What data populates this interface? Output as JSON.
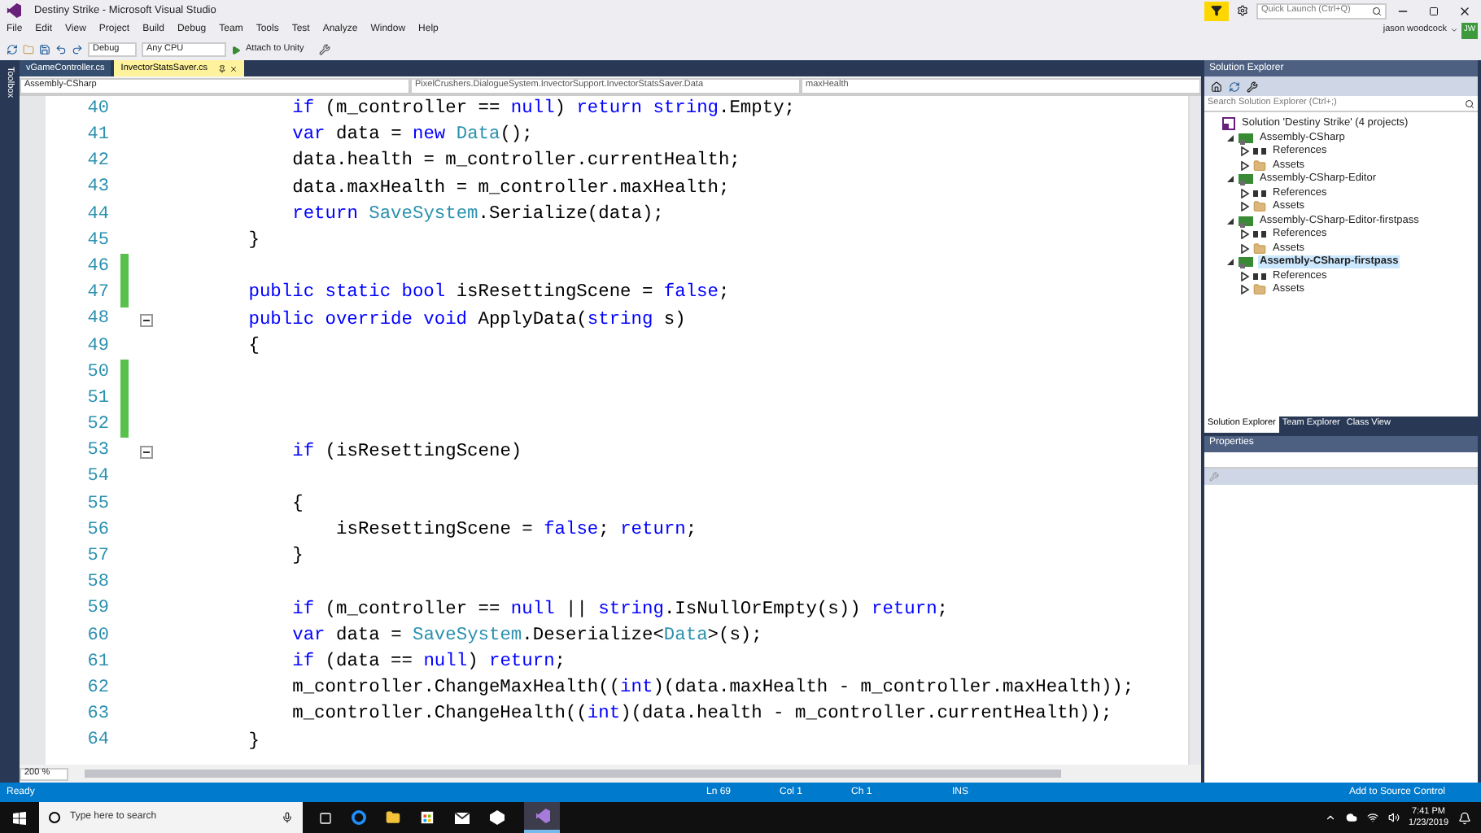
{
  "window": {
    "title": "Destiny Strike - Microsoft Visual Studio"
  },
  "quick_launch": {
    "placeholder": "Quick Launch (Ctrl+Q)"
  },
  "menu": [
    "File",
    "Edit",
    "View",
    "Project",
    "Build",
    "Debug",
    "Team",
    "Tools",
    "Test",
    "Analyze",
    "Window",
    "Help"
  ],
  "user": {
    "name": "jason woodcock",
    "initials": "JW"
  },
  "toolbar": {
    "configuration": "Debug",
    "platform": "Any CPU",
    "run_button": "Attach to Unity"
  },
  "toolbox_label": "Toolbox",
  "editor_tabs": [
    {
      "label": "vGameController.cs",
      "selected": false
    },
    {
      "label": "InvectorStatsSaver.cs",
      "selected": true
    }
  ],
  "nav_bar": {
    "project": "Assembly-CSharp",
    "type": "PixelCrushers.DialogueSystem.InvectorSupport.InvectorStatsSaver.Data",
    "member": "maxHealth"
  },
  "code_lines": [
    {
      "number": "40",
      "changed": false,
      "collapsible": false,
      "tokens": [
        {
          "text": "            if",
          "kind": "keyword"
        },
        {
          "text": " (m_controller == ",
          "kind": "plain"
        },
        {
          "text": "null",
          "kind": "keyword"
        },
        {
          "text": ") ",
          "kind": "plain"
        },
        {
          "text": "return string",
          "kind": "keyword"
        },
        {
          "text": ".Empty;",
          "kind": "plain"
        }
      ]
    },
    {
      "number": "41",
      "changed": false,
      "collapsible": false,
      "tokens": [
        {
          "text": "            var",
          "kind": "keyword"
        },
        {
          "text": " data = ",
          "kind": "plain"
        },
        {
          "text": "new ",
          "kind": "keyword"
        },
        {
          "text": "Data",
          "kind": "type"
        },
        {
          "text": "();",
          "kind": "plain"
        }
      ]
    },
    {
      "number": "42",
      "changed": false,
      "collapsible": false,
      "tokens": [
        {
          "text": "            data.health = m_controller.currentHealth;",
          "kind": "plain"
        }
      ]
    },
    {
      "number": "43",
      "changed": false,
      "collapsible": false,
      "tokens": [
        {
          "text": "            data.maxHealth = m_controller.maxHealth;",
          "kind": "plain"
        }
      ]
    },
    {
      "number": "44",
      "changed": false,
      "collapsible": false,
      "tokens": [
        {
          "text": "            return ",
          "kind": "keyword"
        },
        {
          "text": "SaveSystem",
          "kind": "type"
        },
        {
          "text": ".Serialize(data);",
          "kind": "plain"
        }
      ]
    },
    {
      "number": "45",
      "changed": false,
      "collapsible": false,
      "tokens": [
        {
          "text": "        }",
          "kind": "plain"
        }
      ]
    },
    {
      "number": "46",
      "changed": true,
      "collapsible": false
    },
    {
      "number": "47",
      "changed": true,
      "collapsible": false,
      "tokens": [
        {
          "text": "        public static bool",
          "kind": "keyword"
        },
        {
          "text": " isResettingScene = ",
          "kind": "plain"
        },
        {
          "text": "false",
          "kind": "keyword"
        },
        {
          "text": ";",
          "kind": "plain"
        }
      ]
    },
    {
      "number": "48",
      "changed": false,
      "collapsible": true,
      "tokens": [
        {
          "text": "        public override void",
          "kind": "keyword"
        },
        {
          "text": " ApplyData(",
          "kind": "plain"
        },
        {
          "text": "string",
          "kind": "keyword"
        },
        {
          "text": " s)",
          "kind": "plain"
        }
      ]
    },
    {
      "number": "49",
      "changed": false,
      "collapsible": false,
      "tokens": [
        {
          "text": "        {",
          "kind": "plain"
        }
      ]
    },
    {
      "number": "50",
      "changed": true,
      "collapsible": false
    },
    {
      "number": "51",
      "changed": true,
      "collapsible": false
    },
    {
      "number": "52",
      "changed": true,
      "collapsible": false
    },
    {
      "number": "53",
      "changed": false,
      "collapsible": true,
      "tokens": [
        {
          "text": "            if",
          "kind": "keyword"
        },
        {
          "text": " (isResettingScene)",
          "kind": "plain"
        }
      ]
    },
    {
      "number": "54",
      "changed": false,
      "collapsible": false
    },
    {
      "number": "55",
      "changed": false,
      "collapsible": false,
      "tokens": [
        {
          "text": "            {",
          "kind": "plain"
        }
      ]
    },
    {
      "number": "56",
      "changed": false,
      "collapsible": false,
      "tokens": [
        {
          "text": "                isResettingScene = ",
          "kind": "plain"
        },
        {
          "text": "false",
          "kind": "keyword"
        },
        {
          "text": "; ",
          "kind": "plain"
        },
        {
          "text": "return",
          "kind": "keyword"
        },
        {
          "text": ";",
          "kind": "plain"
        }
      ]
    },
    {
      "number": "57",
      "changed": false,
      "collapsible": false,
      "tokens": [
        {
          "text": "            }",
          "kind": "plain"
        }
      ]
    },
    {
      "number": "58",
      "changed": false,
      "collapsible": false
    },
    {
      "number": "59",
      "changed": false,
      "collapsible": false,
      "tokens": [
        {
          "text": "            if",
          "kind": "keyword"
        },
        {
          "text": " (m_controller == ",
          "kind": "plain"
        },
        {
          "text": "null",
          "kind": "keyword"
        },
        {
          "text": " || ",
          "kind": "plain"
        },
        {
          "text": "string",
          "kind": "keyword"
        },
        {
          "text": ".IsNullOrEmpty(s)) ",
          "kind": "plain"
        },
        {
          "text": "return",
          "kind": "keyword"
        },
        {
          "text": ";",
          "kind": "plain"
        }
      ]
    },
    {
      "number": "60",
      "changed": false,
      "collapsible": false,
      "tokens": [
        {
          "text": "            var",
          "kind": "keyword"
        },
        {
          "text": " data = ",
          "kind": "plain"
        },
        {
          "text": "SaveSystem",
          "kind": "type"
        },
        {
          "text": ".Deserialize<",
          "kind": "plain"
        },
        {
          "text": "Data",
          "kind": "type"
        },
        {
          "text": ">(s);",
          "kind": "plain"
        }
      ]
    },
    {
      "number": "61",
      "changed": false,
      "collapsible": false,
      "tokens": [
        {
          "text": "            if",
          "kind": "keyword"
        },
        {
          "text": " (data == ",
          "kind": "plain"
        },
        {
          "text": "null",
          "kind": "keyword"
        },
        {
          "text": ") ",
          "kind": "plain"
        },
        {
          "text": "return",
          "kind": "keyword"
        },
        {
          "text": ";",
          "kind": "plain"
        }
      ]
    },
    {
      "number": "62",
      "changed": false,
      "collapsible": false,
      "tokens": [
        {
          "text": "            m_controller.ChangeMaxHealth((",
          "kind": "plain"
        },
        {
          "text": "int",
          "kind": "keyword"
        },
        {
          "text": ")(data.maxHealth - m_controller.maxHealth));",
          "kind": "plain"
        }
      ]
    },
    {
      "number": "63",
      "changed": false,
      "collapsible": false,
      "tokens": [
        {
          "text": "            m_controller.ChangeHealth((",
          "kind": "plain"
        },
        {
          "text": "int",
          "kind": "keyword"
        },
        {
          "text": ")(data.health - m_controller.currentHealth));",
          "kind": "plain"
        }
      ]
    },
    {
      "number": "64",
      "changed": false,
      "collapsible": false,
      "tokens": [
        {
          "text": "        }",
          "kind": "plain"
        }
      ]
    }
  ],
  "zoom": "200 %",
  "solution_explorer": {
    "title": "Solution Explorer",
    "search_placeholder": "Search Solution Explorer (Ctrl+;)",
    "tree": [
      {
        "label": "Solution 'Destiny Strike' (4 projects)",
        "kind": "solution",
        "selected": false,
        "children": [
          {
            "label": "Assembly-CSharp",
            "kind": "project",
            "expanded": true,
            "selected": false,
            "children": [
              {
                "label": "References",
                "kind": "references",
                "expanded": false,
                "selected": false
              },
              {
                "label": "Assets",
                "kind": "folder",
                "expanded": false,
                "selected": false
              }
            ]
          },
          {
            "label": "Assembly-CSharp-Editor",
            "kind": "project",
            "expanded": true,
            "selected": false,
            "children": [
              {
                "label": "References",
                "kind": "references",
                "expanded": false,
                "selected": false
              },
              {
                "label": "Assets",
                "kind": "folder",
                "expanded": false,
                "selected": false
              }
            ]
          },
          {
            "label": "Assembly-CSharp-Editor-firstpass",
            "kind": "project",
            "expanded": true,
            "selected": false,
            "children": [
              {
                "label": "References",
                "kind": "references",
                "expanded": false,
                "selected": false
              },
              {
                "label": "Assets",
                "kind": "folder",
                "expanded": false,
                "selected": false
              }
            ]
          },
          {
            "label": "Assembly-CSharp-firstpass",
            "kind": "project",
            "expanded": true,
            "selected": true,
            "children": [
              {
                "label": "References",
                "kind": "references",
                "expanded": false,
                "selected": false
              },
              {
                "label": "Assets",
                "kind": "folder",
                "expanded": false,
                "selected": false
              }
            ]
          }
        ]
      }
    ]
  },
  "panel_tabs": [
    {
      "label": "Solution Explorer",
      "selected": true
    },
    {
      "label": "Team Explorer",
      "selected": false
    },
    {
      "label": "Class View",
      "selected": false
    }
  ],
  "properties": {
    "title": "Properties"
  },
  "status_bar": {
    "state": "Ready",
    "ln": "Ln 69",
    "col": "Col 1",
    "ch": "Ch 1",
    "mode": "INS",
    "source_control": "Add to Source Control"
  },
  "taskbar": {
    "search_placeholder": "Type here to search",
    "time": "7:41 PM",
    "date": "1/23/2019"
  }
}
